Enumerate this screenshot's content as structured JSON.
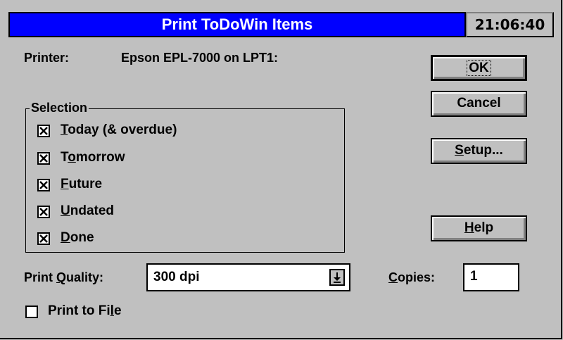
{
  "window": {
    "title": "Print ToDoWin Items",
    "clock": "21:06:40"
  },
  "printer": {
    "label": "Printer:",
    "value": "Epson EPL-7000 on LPT1:"
  },
  "selection": {
    "title": "Selection",
    "items": [
      {
        "pre": "",
        "key": "T",
        "post": "oday (& overdue)",
        "checked": true
      },
      {
        "pre": "T",
        "key": "o",
        "post": "morrow",
        "checked": true
      },
      {
        "pre": "",
        "key": "F",
        "post": "uture",
        "checked": true
      },
      {
        "pre": "",
        "key": "U",
        "post": "ndated",
        "checked": true
      },
      {
        "pre": "",
        "key": "D",
        "post": "one",
        "checked": true
      }
    ]
  },
  "buttons": {
    "ok": "OK",
    "cancel": "Cancel",
    "setup": {
      "key": "S",
      "post": "etup..."
    },
    "help": {
      "key": "H",
      "post": "elp"
    }
  },
  "print_quality": {
    "pre": "Print ",
    "key": "Q",
    "post": "uality:",
    "value": "300 dpi"
  },
  "copies": {
    "key": "C",
    "post": "opies:",
    "value": "1"
  },
  "print_to_file": {
    "pre": "Print to Fi",
    "key": "l",
    "post": "e",
    "checked": false
  }
}
